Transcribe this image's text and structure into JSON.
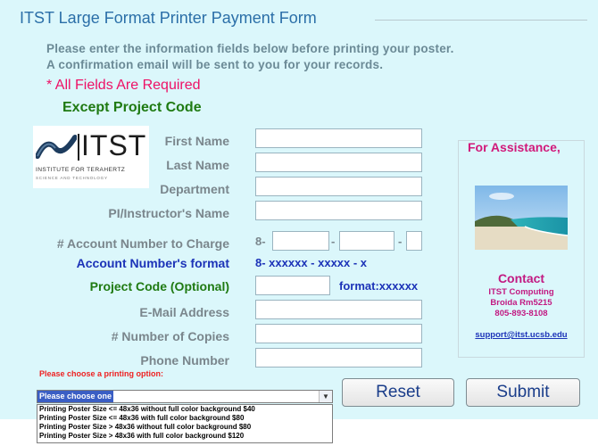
{
  "form": {
    "title": "ITST Large Format Printer Payment Form",
    "intro_line1": "Please enter the information fields below before printing your poster.",
    "intro_line2": "A confirmation email will be sent to you for your records.",
    "required_note": "* All Fields Are Required",
    "except_note": "Except Project Code"
  },
  "logo": {
    "text": "ITST",
    "subtitle": "INSTITUTE FOR TERAHERTZ",
    "subtitle2": "SCIENCE AND TECHNOLOGY"
  },
  "fields": {
    "first_name": {
      "label": "First Name",
      "value": ""
    },
    "last_name": {
      "label": "Last Name",
      "value": ""
    },
    "department": {
      "label": "Department",
      "value": ""
    },
    "pi_name": {
      "label": "PI/Instructor's Name",
      "value": ""
    },
    "account": {
      "label": "# Account Number to Charge",
      "prefix": "8-",
      "sep1": "-",
      "sep2": "-",
      "part1": "",
      "part2": "",
      "part3": ""
    },
    "account_format": {
      "label": "Account Number's format",
      "value": "8-  xxxxxx  - xxxxx  - x"
    },
    "project_code": {
      "label": "Project Code (Optional)",
      "value": "",
      "format_hint": "format:xxxxxx"
    },
    "email": {
      "label": "E-Mail Address",
      "value": ""
    },
    "copies": {
      "label": "# Number of Copies",
      "value": ""
    },
    "phone": {
      "label": "Phone Number",
      "value": ""
    }
  },
  "assistance": {
    "title": "For Assistance,",
    "contact_heading": "Contact",
    "line1": "ITST Computing",
    "line2": "Broida Rm5215",
    "line3": "805-893-8108",
    "email_link": "support@itst.ucsb.edu"
  },
  "printing": {
    "prompt": "Please choose a printing option:",
    "selected": "Please choose one",
    "options": [
      "Printing Poster Size <= 48x36 without full color background $40",
      "Printing Poster Size <= 48x36 with full color background $80",
      "Printing Poster Size > 48x36 without full color background $80",
      "Printing Poster Size > 48x36 with full color background $120"
    ]
  },
  "buttons": {
    "reset": "Reset",
    "submit": "Submit"
  },
  "colors": {
    "background": "#dbf7fb",
    "title": "#2b6fa8",
    "required": "#ee1166",
    "green": "#1f7a12",
    "blue": "#1c33b8",
    "magenta": "#c21a82"
  }
}
